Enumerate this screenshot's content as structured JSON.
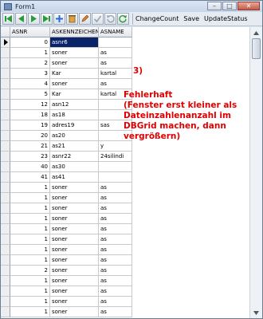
{
  "window": {
    "title": "Form1",
    "controls": {
      "minimize": "–",
      "maximize": "□",
      "close": "✕"
    }
  },
  "toolbar": {
    "nav_buttons": [
      "first-icon",
      "prior-icon",
      "next-icon",
      "last-icon",
      "insert-icon",
      "delete-icon",
      "edit-icon",
      "post-icon",
      "cancel-icon",
      "refresh-icon"
    ],
    "change_count_label": "ChangeCount",
    "save_label": "Save",
    "update_status_label": "UpdateStatus"
  },
  "grid": {
    "columns": [
      "ASNR",
      "ASKENNZEICHEN",
      "ASNAME"
    ],
    "rows": [
      {
        "asnr": "0",
        "askennzeichen": "asnr6",
        "asname": ""
      },
      {
        "asnr": "1",
        "askennzeichen": "soner",
        "asname": "as"
      },
      {
        "asnr": "2",
        "askennzeichen": "soner",
        "asname": "as"
      },
      {
        "asnr": "3",
        "askennzeichen": "Kar",
        "asname": "kartal"
      },
      {
        "asnr": "4",
        "askennzeichen": "soner",
        "asname": "as"
      },
      {
        "asnr": "5",
        "askennzeichen": "Kar",
        "asname": "kartal"
      },
      {
        "asnr": "12",
        "askennzeichen": "asn12",
        "asname": ""
      },
      {
        "asnr": "18",
        "askennzeichen": "as18",
        "asname": ""
      },
      {
        "asnr": "19",
        "askennzeichen": "adres19",
        "asname": "sas"
      },
      {
        "asnr": "20",
        "askennzeichen": "as20",
        "asname": ""
      },
      {
        "asnr": "21",
        "askennzeichen": "as21",
        "asname": "y"
      },
      {
        "asnr": "23",
        "askennzeichen": "asnr22",
        "asname": "24silindi"
      },
      {
        "asnr": "40",
        "askennzeichen": "as30",
        "asname": ""
      },
      {
        "asnr": "41",
        "askennzeichen": "as41",
        "asname": ""
      },
      {
        "asnr": "1",
        "askennzeichen": "soner",
        "asname": "as"
      },
      {
        "asnr": "1",
        "askennzeichen": "soner",
        "asname": "as"
      },
      {
        "asnr": "1",
        "askennzeichen": "soner",
        "asname": "as"
      },
      {
        "asnr": "1",
        "askennzeichen": "soner",
        "asname": "as"
      },
      {
        "asnr": "1",
        "askennzeichen": "soner",
        "asname": "as"
      },
      {
        "asnr": "1",
        "askennzeichen": "soner",
        "asname": "as"
      },
      {
        "asnr": "1",
        "askennzeichen": "soner",
        "asname": "as"
      },
      {
        "asnr": "1",
        "askennzeichen": "soner",
        "asname": "as"
      },
      {
        "asnr": "2",
        "askennzeichen": "soner",
        "asname": "as"
      },
      {
        "asnr": "1",
        "askennzeichen": "soner",
        "asname": "as"
      },
      {
        "asnr": "1",
        "askennzeichen": "soner",
        "asname": "as"
      },
      {
        "asnr": "1",
        "askennzeichen": "soner",
        "asname": "as"
      },
      {
        "asnr": "1",
        "askennzeichen": "soner",
        "asname": "as"
      }
    ]
  },
  "annotation": {
    "number": "3)",
    "lines": [
      "Fehlerhaft",
      "(Fenster erst kleiner als",
      "Dateinzahlenanzahl im",
      "DBGrid machen, dann",
      "vergrößern)"
    ],
    "color": "#e00000"
  },
  "colors": {
    "selection": "#0a246a",
    "nav_arrow": "#2a9a3a"
  }
}
